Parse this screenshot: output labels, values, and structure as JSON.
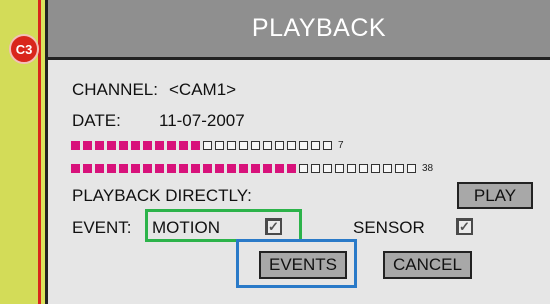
{
  "badge": {
    "label": "C3"
  },
  "dialog": {
    "title": "PLAYBACK",
    "channel_label": "CHANNEL:",
    "channel_value": "<CAM1>",
    "date_label": "DATE:",
    "date_value": "11-07-2007",
    "bars": [
      {
        "filled": 11,
        "total": 22,
        "count": "7"
      },
      {
        "filled": 19,
        "total": 29,
        "count": "38"
      }
    ],
    "playback_directly_label": "PLAYBACK DIRECTLY:",
    "play_button": "PLAY",
    "event_label": "EVENT:",
    "motion_label": "MOTION",
    "motion_checked": true,
    "sensor_label": "SENSOR",
    "sensor_checked": true,
    "events_button": "EVENTS",
    "cancel_button": "CANCEL"
  },
  "colors": {
    "page_bg": "#dbe25c",
    "accent_red": "#d9261c",
    "filled_square": "#d8127b",
    "highlight_green": "#2cb34a",
    "highlight_blue": "#2a7ac8",
    "titlebar": "#8f8f8f"
  }
}
